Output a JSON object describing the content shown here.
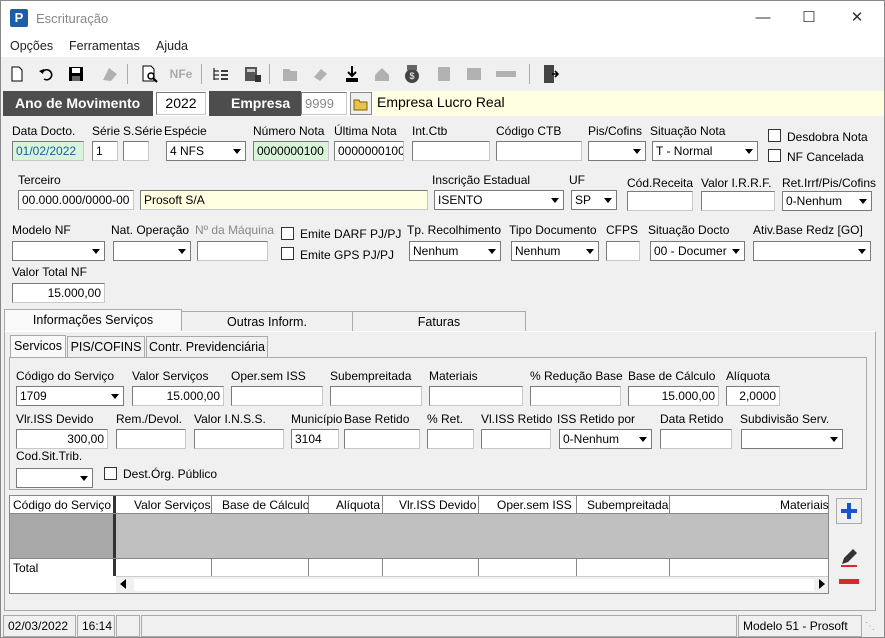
{
  "window": {
    "title": "Escrituração"
  },
  "menu": [
    "Opções",
    "Ferramentas",
    "Ajuda"
  ],
  "header": {
    "ano_label": "Ano de Movimento",
    "ano": "2022",
    "empresa_label": "Empresa",
    "empresa_cod": "9999",
    "empresa_nome": "Empresa Lucro Real"
  },
  "labels": {
    "data_docto": "Data Docto.",
    "serie": "Série",
    "s_serie": "S.Série",
    "especie": "Espécie",
    "numero_nota": "Número Nota",
    "ultima_nota": "Última Nota",
    "int_ctb": "Int.Ctb",
    "codigo_ctb": "Código CTB",
    "pis_cofins": "Pis/Cofins",
    "situacao_nota": "Situação Nota",
    "desdobra": "Desdobra Nota",
    "nf_cancelada": "NF Cancelada",
    "terceiro": "Terceiro",
    "inscricao": "Inscrição Estadual",
    "uf": "UF",
    "cod_receita": "Cód.Receita",
    "valor_irrf": "Valor I.R.R.F.",
    "ret_irrf": "Ret.Irrf/Pis/Cofins",
    "modelo_nf": "Modelo NF",
    "nat_operacao": "Nat. Operação",
    "num_maquina": "Nº da Máquina",
    "emite_darf": "Emite DARF PJ/PJ",
    "emite_gps": "Emite GPS PJ/PJ",
    "tp_recolhimento": "Tp. Recolhimento",
    "tipo_documento": "Tipo Documento",
    "cfps": "CFPS",
    "situacao_docto": "Situação Docto",
    "ativ_base": "Ativ.Base Redz [GO]",
    "valor_total_nf": "Valor Total NF"
  },
  "values": {
    "data_docto": "01/02/2022",
    "serie": "1",
    "s_serie": "",
    "especie": "4 NFS",
    "numero_nota": "0000000100",
    "ultima_nota": "0000000100",
    "int_ctb": "",
    "codigo_ctb": "",
    "pis_cofins": "",
    "situacao_nota": "T - Normal",
    "terceiro_cnpj": "00.000.000/0000-00",
    "terceiro_nome": "Prosoft S/A",
    "inscricao": "ISENTO",
    "uf": "SP",
    "cod_receita": "",
    "valor_irrf": "",
    "ret_irrf": "0-Nenhum",
    "modelo_nf": "",
    "nat_operacao": "",
    "num_maquina": "",
    "tp_recolhimento": "Nenhum",
    "tipo_documento": "Nenhum",
    "cfps": "",
    "situacao_docto": "00 - Documer",
    "ativ_base": "",
    "valor_total_nf": "15.000,00"
  },
  "tabs": [
    "Informações Serviços",
    "Outras Inform.",
    "Faturas"
  ],
  "subtabs": [
    "Servicos",
    "PIS/COFINS",
    "Contr. Previdenciária"
  ],
  "servicos": {
    "labels": {
      "codigo_servico": "Código do Serviço",
      "valor_servicos": "Valor Serviços",
      "oper_sem_iss": "Oper.sem ISS",
      "subempreitada": "Subempreitada",
      "materiais": "Materiais",
      "pct_reducao": "% Redução Base",
      "base_calculo": "Base de Cálculo",
      "aliquota": "Alíquota",
      "vlr_iss_devido": "Vlr.ISS Devido",
      "rem_devol": "Rem./Devol.",
      "valor_inss": "Valor I.N.S.S.",
      "municipio": "Município",
      "base_retido": "Base Retido",
      "pct_ret": "% Ret.",
      "vl_iss_retido": "Vl.ISS Retido",
      "iss_retido_por": "ISS Retido por",
      "data_retido": "Data Retido",
      "subdivisao": "Subdivisão Serv.",
      "cod_sit_trib": "Cod.Sit.Trib.",
      "dest_org": "Dest.Órg. Público"
    },
    "values": {
      "codigo_servico": "1709",
      "valor_servicos": "15.000,00",
      "base_calculo": "15.000,00",
      "aliquota": "2,0000",
      "vlr_iss_devido": "300,00",
      "municipio": "3104",
      "iss_retido_por": "0-Nenhum"
    }
  },
  "grid": {
    "columns": [
      "Código do Serviço",
      "Valor Serviços",
      "Base de Cálculo",
      "Alíquota",
      "Vlr.ISS Devido",
      "Oper.sem ISS",
      "Subempreitada",
      "Materiais"
    ],
    "total_label": "Total"
  },
  "status": {
    "date": "02/03/2022",
    "time": "16:14",
    "model": "Modelo 51 - Prosoft"
  },
  "colors": {
    "accent": "#1c5fa8",
    "header_bg": "#4d4d4d",
    "input_green": "#d9f5d9",
    "input_yellow": "#ffffe1",
    "add": "#1a56c7",
    "remove": "#d9272e"
  }
}
